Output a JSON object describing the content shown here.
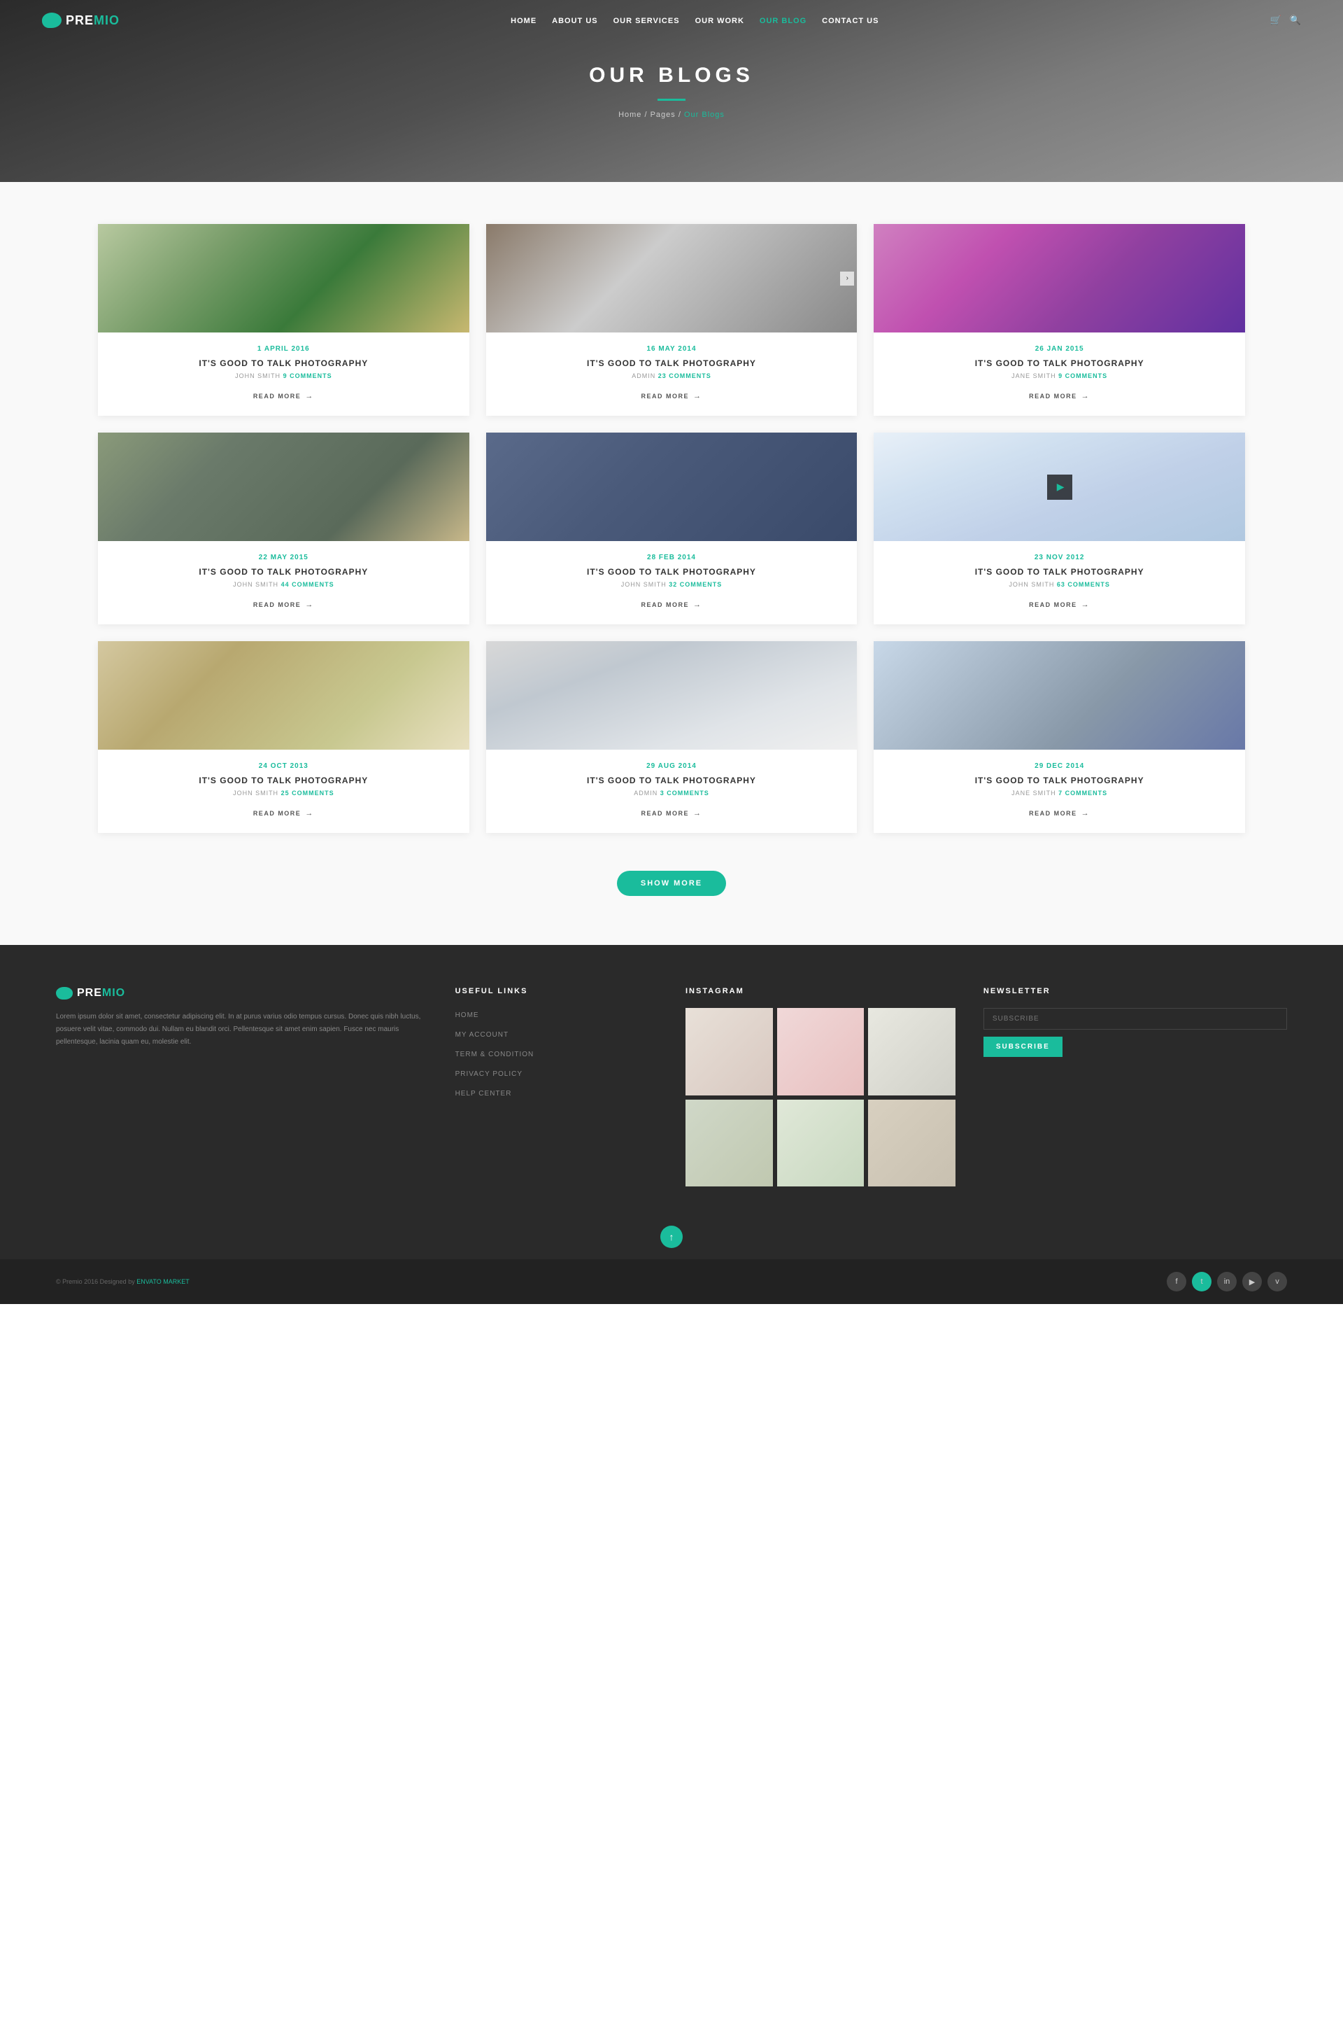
{
  "brand": {
    "name_pre": "PRE",
    "name_post": "MIO"
  },
  "nav": {
    "links": [
      {
        "label": "HOME",
        "href": "#",
        "active": false
      },
      {
        "label": "ABOUT US",
        "href": "#",
        "active": false
      },
      {
        "label": "OUR SERVICES",
        "href": "#",
        "active": false
      },
      {
        "label": "OUR WORK",
        "href": "#",
        "active": false
      },
      {
        "label": "OUR BLOG",
        "href": "#",
        "active": true
      },
      {
        "label": "CONTACT US",
        "href": "#",
        "active": false
      }
    ]
  },
  "hero": {
    "title": "OUR BLOGS",
    "breadcrumb_home": "Home",
    "breadcrumb_pages": "Pages",
    "breadcrumb_current": "Our Blogs"
  },
  "blog_rows": [
    {
      "cards": [
        {
          "date": "1 APRIL 2016",
          "title": "IT'S GOOD TO TALK PHOTOGRAPHY",
          "author": "JOHN SMITH",
          "comments": "9 COMMENTS",
          "read_more": "READ MORE",
          "img_class": "img-1",
          "has_carousel": false
        },
        {
          "date": "16 MAY 2014",
          "title": "IT'S GOOD TO TALK PHOTOGRAPHY",
          "author": "ADMIN",
          "comments": "23 COMMENTS",
          "read_more": "READ MORE",
          "img_class": "img-2",
          "has_carousel": true
        },
        {
          "date": "26 JAN 2015",
          "title": "IT'S GOOD TO TALK PHOTOGRAPHY",
          "author": "JANE SMITH",
          "comments": "9 COMMENTS",
          "read_more": "READ MORE",
          "img_class": "img-3",
          "has_carousel": false
        }
      ]
    },
    {
      "cards": [
        {
          "date": "22 MAY 2015",
          "title": "IT'S GOOD TO TALK PHOTOGRAPHY",
          "author": "JOHN SMITH",
          "comments": "44 COMMENTS",
          "read_more": "READ MORE",
          "img_class": "img-4",
          "has_carousel": false
        },
        {
          "date": "28 FEB 2014",
          "title": "IT'S GOOD TO TALK PHOTOGRAPHY",
          "author": "JOHN SMITH",
          "comments": "32 COMMENTS",
          "read_more": "READ MORE",
          "img_class": "img-5",
          "has_carousel": false
        },
        {
          "date": "23 NOV 2012",
          "title": "IT'S GOOD TO TALK PHOTOGRAPHY",
          "author": "JOHN SMITH",
          "comments": "63 COMMENTS",
          "read_more": "READ MORE",
          "img_class": "img-6",
          "has_play": true,
          "has_carousel": false
        }
      ]
    },
    {
      "cards": [
        {
          "date": "24 OCT 2013",
          "title": "IT'S GOOD TO TALK PHOTOGRAPHY",
          "author": "JOHN SMITH",
          "comments": "25 COMMENTS",
          "read_more": "READ MORE",
          "img_class": "img-7",
          "has_carousel": false
        },
        {
          "date": "29 AUG 2014",
          "title": "IT'S GOOD TO TALK PHOTOGRAPHY",
          "author": "ADMIN",
          "comments": "3 COMMENTS",
          "read_more": "READ MORE",
          "img_class": "img-8",
          "has_carousel": false
        },
        {
          "date": "29 DEC 2014",
          "title": "IT'S GOOD TO TALK PHOTOGRAPHY",
          "author": "JANE SMITH",
          "comments": "7 COMMENTS",
          "read_more": "READ MORE",
          "img_class": "img-9",
          "has_carousel": false
        }
      ]
    }
  ],
  "show_more": "SHOW MORE",
  "footer": {
    "desc": "Lorem ipsum dolor sit amet, consectetur adipiscing elit. In at purus varius odio tempus cursus. Donec quis nibh luctus, posuere velit vitae, commodo dui. Nullam eu blandit orci. Pellentesque sit amet enim sapien. Fusce nec mauris pellentesque, lacinia quam eu, molestie elit.",
    "useful_links_title": "USEFUL LINKS",
    "useful_links": [
      {
        "label": "HOME"
      },
      {
        "label": "MY ACCOUNT"
      },
      {
        "label": "TERM & CONDITION"
      },
      {
        "label": "PRIVACY POLICY"
      },
      {
        "label": "HELP CENTER"
      }
    ],
    "instagram_title": "INSTAGRAM",
    "newsletter_title": "NEWSLETTER",
    "newsletter_placeholder": "SUBSCRIBE",
    "newsletter_btn": "SUBSCRIBE",
    "copy": "© Premio 2016 Designed by",
    "copy_link": "ENVATO MARKET",
    "social": [
      {
        "icon": "f",
        "name": "facebook"
      },
      {
        "icon": "t",
        "name": "twitter"
      },
      {
        "icon": "in",
        "name": "linkedin"
      },
      {
        "icon": "▶",
        "name": "youtube"
      },
      {
        "icon": "v",
        "name": "vimeo"
      }
    ]
  }
}
